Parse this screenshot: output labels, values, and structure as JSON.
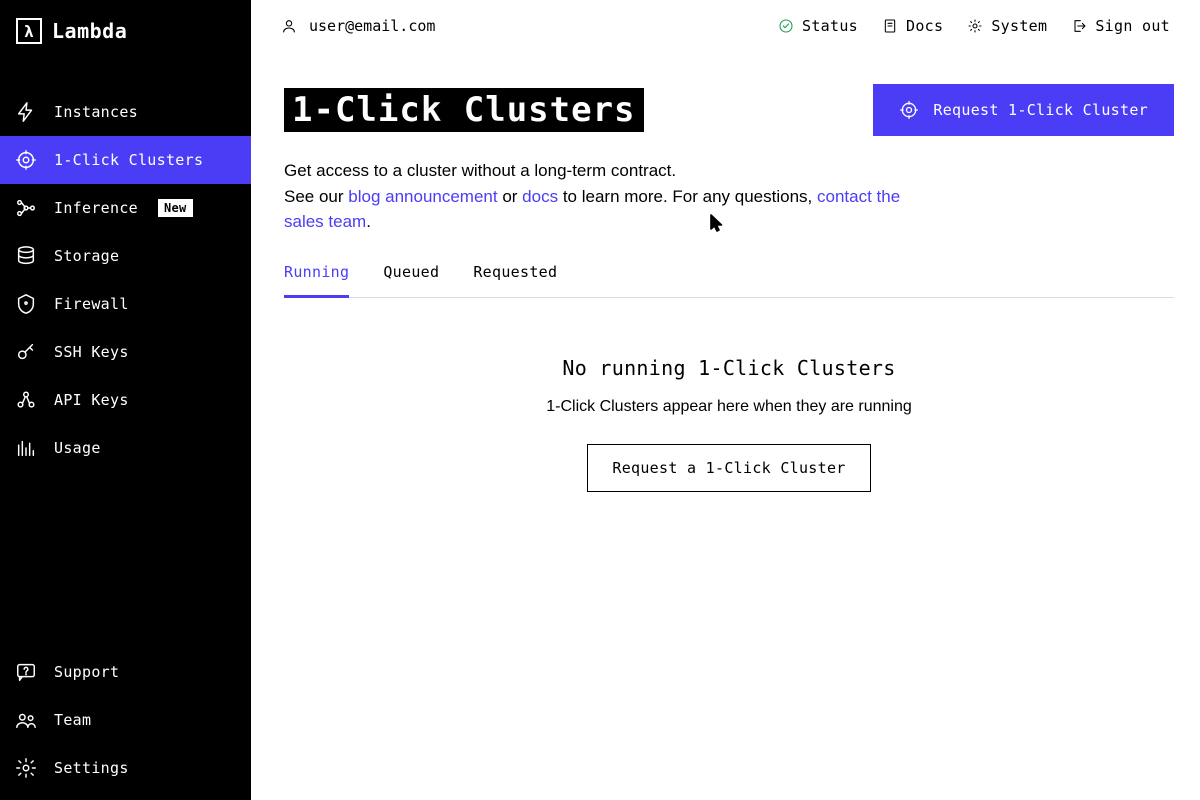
{
  "brand": "Lambda",
  "topbar": {
    "user_email": "user@email.com",
    "links": {
      "status": "Status",
      "docs": "Docs",
      "system": "System",
      "signout": "Sign out"
    }
  },
  "sidebar": {
    "top": [
      {
        "label": "Instances"
      },
      {
        "label": "1-Click Clusters"
      },
      {
        "label": "Inference",
        "badge": "New"
      },
      {
        "label": "Storage"
      },
      {
        "label": "Firewall"
      },
      {
        "label": "SSH Keys"
      },
      {
        "label": "API Keys"
      },
      {
        "label": "Usage"
      }
    ],
    "bottom": [
      {
        "label": "Support"
      },
      {
        "label": "Team"
      },
      {
        "label": "Settings"
      }
    ]
  },
  "page": {
    "title": "1-Click Clusters",
    "request_btn": "Request 1-Click Cluster",
    "desc1": "Get access to a cluster without a long-term contract.",
    "desc2a": "See our ",
    "link_blog": "blog announcement",
    "desc2b": " or ",
    "link_docs": "docs",
    "desc2c": " to learn more. For any questions, ",
    "link_contact": "contact the sales team",
    "desc2d": "."
  },
  "tabs": {
    "t0": "Running",
    "t1": "Queued",
    "t2": "Requested"
  },
  "empty": {
    "title": "No running 1-Click Clusters",
    "sub": "1-Click Clusters appear here when they are running",
    "cta": "Request a 1-Click Cluster"
  }
}
